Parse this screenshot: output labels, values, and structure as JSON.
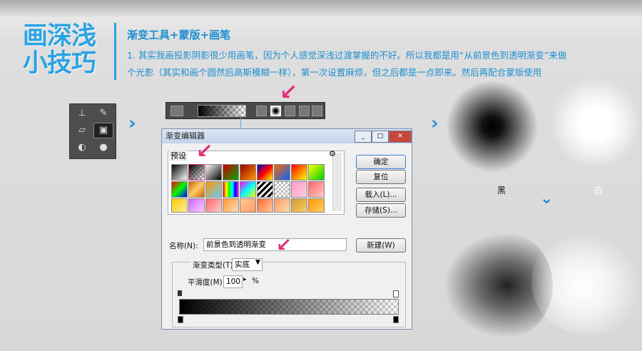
{
  "header": {
    "big_title_line1": "画深浅",
    "big_title_line2": "小技巧",
    "subtitle": "渐变工具+蒙版+画笔",
    "paragraph_line1": "1. 其实我画投影阴影很少用画笔，因为个人感觉深浅过渡掌握的不好。所以我都是用“从前景色到透明渐变”来做",
    "paragraph_line2": "个光影（其实和画个圆然后高斯模糊一样），第一次设置麻烦，但之后都是一点即来。然后再配合蒙版使用"
  },
  "toolbox": {
    "tools": [
      {
        "icon": "stamp-icon",
        "glyph": "⊥"
      },
      {
        "icon": "history-brush-icon",
        "glyph": "✎"
      },
      {
        "icon": "eraser-icon",
        "glyph": "▱"
      },
      {
        "icon": "gradient-icon",
        "glyph": "▣"
      },
      {
        "icon": "blur-icon",
        "glyph": "◐"
      },
      {
        "icon": "dodge-icon",
        "glyph": "●"
      }
    ]
  },
  "arrows": {
    "right": "›",
    "down": "⌄"
  },
  "dialog": {
    "title": "渐变编辑器",
    "presets_label": "预设",
    "buttons": {
      "ok": "确定",
      "reset": "复位",
      "load": "载入(L)...",
      "save": "存储(S)...",
      "new": "新建(W)"
    },
    "name_label": "名称(N):",
    "name_value": "前景色到透明渐变",
    "gradient_type_label": "渐变类型(T):",
    "gradient_type_value": "实底",
    "smoothness_label": "平滑度(M):",
    "smoothness_value": "100",
    "smoothness_unit": "%"
  },
  "samples": {
    "black_label": "黑",
    "white_label": "白"
  },
  "colors": {
    "accent": "#2aa3e3",
    "arrow": "#1f8fd6",
    "callout": "#e0307a"
  }
}
